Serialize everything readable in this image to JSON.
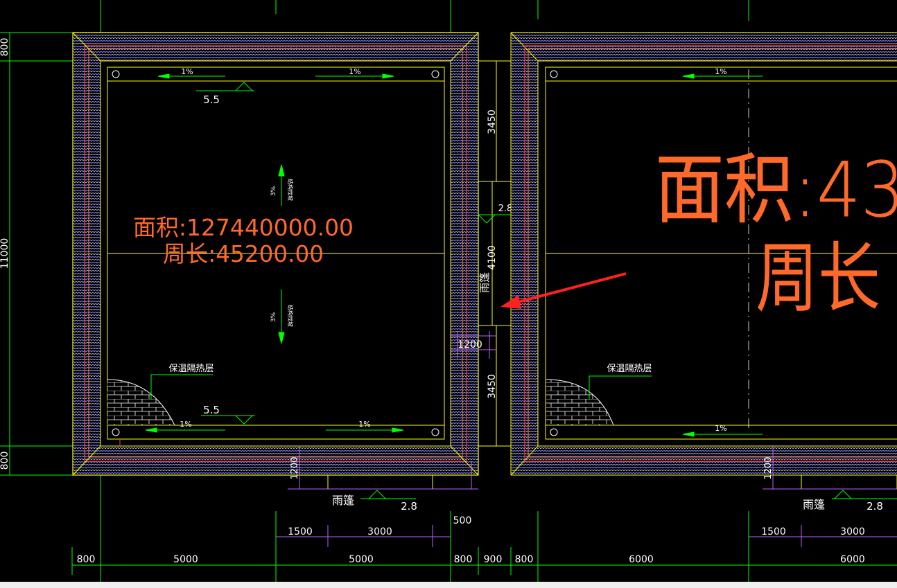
{
  "colors": {
    "background": "#000000",
    "axis": "#00ff00",
    "wall": "#ffff00",
    "tile": "#8080ff",
    "insulation": "#ff4040",
    "area_text": "#ff6a2a",
    "dim": "#00ff00",
    "dim_text": "#ffffff",
    "arrow": "#00ff00",
    "dim_purple": "#c060ff",
    "pointer": "#ff2020",
    "hatch": "#ffffff"
  },
  "left_roof": {
    "area_label": "面积:127440000.00",
    "perimeter_label": "周长:45200.00",
    "slope_top_left": "1%",
    "slope_top_right": "1%",
    "slope_bottom_left": "1%",
    "slope_bottom_right": "1%",
    "elevation_top": "5.5",
    "elevation_bottom": "5.5",
    "slope_vertical_up": "3%",
    "slope_vertical_down": "3%",
    "slope_vertical_note_up": "结构找坡",
    "slope_vertical_note_down": "结构找坡",
    "insulation_label": "保温隔热层"
  },
  "right_roof": {
    "area_label": "面积:43",
    "perimeter_label": "周长",
    "slope_top": "1%",
    "slope_bottom": "1%",
    "insulation_label": "保温隔热层"
  },
  "canopy_middle": {
    "label": "雨篷",
    "elevation": "2.8",
    "dim_top": "3450",
    "dim_mid": "4100",
    "dim_bottom": "3450",
    "dim_width": "1200"
  },
  "canopy_bottom_left": {
    "label": "雨篷",
    "elevation": "2.8",
    "dim_depth": "1200",
    "dim_1": "1500",
    "dim_2": "3000",
    "dim_3": "500"
  },
  "canopy_bottom_right": {
    "label": "雨篷",
    "elevation": "2.8",
    "dim_depth": "1200",
    "dim_1": "1500",
    "dim_2": "3000"
  },
  "left_dims": {
    "top": "800",
    "middle": "11000",
    "bottom": "800"
  },
  "bottom_dims": [
    "800",
    "5000",
    "5000",
    "800",
    "900",
    "800",
    "6000",
    "6000"
  ]
}
